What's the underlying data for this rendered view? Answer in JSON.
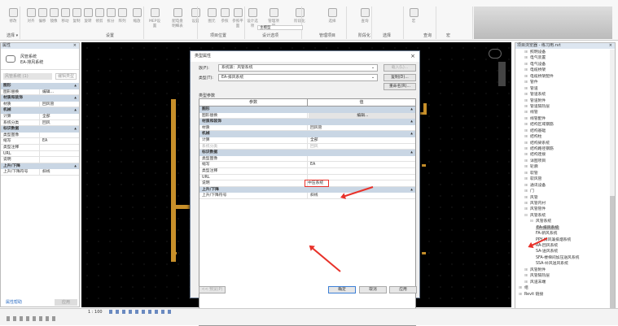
{
  "ribbon": {
    "buttons": [
      "修改",
      "对齐",
      "偏移",
      "镜像",
      "移动",
      "复制",
      "旋转",
      "修剪",
      "拆分",
      "阵列",
      "缩放",
      "MEP设置",
      "配电盘明细表",
      "设置",
      "图元",
      "参照",
      "参照平面",
      "设计选项",
      "管理项目",
      "阶段化",
      "选择",
      "查询",
      "宏"
    ],
    "panels": [
      "选择 ▾",
      "设置",
      "项目位置",
      "设计选项",
      "管理项目",
      "阶段化",
      "选择",
      "查询",
      "宏"
    ],
    "design_option_value": "主模型"
  },
  "properties": {
    "title": "属性",
    "close": "×",
    "type_name": "风管系统",
    "type_sub": "EA-排风系统",
    "selector": "风管系统 (1)",
    "edit_type": "编辑类型",
    "rows": [
      {
        "s": "图形"
      },
      {
        "k": "图形替换",
        "v": "编辑..."
      },
      {
        "s": "材质和装饰"
      },
      {
        "k": "材质",
        "v": "回风管"
      },
      {
        "s": "机械"
      },
      {
        "k": "计算",
        "v": "全部"
      },
      {
        "k": "系统分类",
        "v": "回风"
      },
      {
        "s": "标识数据"
      },
      {
        "k": "类型图像",
        "v": ""
      },
      {
        "k": "缩写",
        "v": "EA"
      },
      {
        "k": "类型注释",
        "v": ""
      },
      {
        "k": "URL",
        "v": ""
      },
      {
        "k": "说明",
        "v": ""
      },
      {
        "s": "上升/下降"
      },
      {
        "k": "上升/下降符号",
        "v": "斜线"
      }
    ],
    "help": "属性帮助",
    "apply": "应用"
  },
  "dialog": {
    "title": "类型属性",
    "close": "×",
    "family_label": "族(F):",
    "family_value": "系统族：风管系统",
    "type_label": "类型(T):",
    "type_value": "EA-排风系统",
    "load": "载入(L)...",
    "duplicate": "复制(D)...",
    "rename": "重命名(R)...",
    "params_label": "类型参数",
    "col_param": "参数",
    "col_value": "值",
    "rows": [
      {
        "s": "图形"
      },
      {
        "k": "图形替换",
        "v": "编辑...",
        "btn": true
      },
      {
        "s": "材质和装饰"
      },
      {
        "k": "材质",
        "v": "回风管"
      },
      {
        "s": "机械"
      },
      {
        "k": "计算",
        "v": "全部"
      },
      {
        "k": "系统分类",
        "v": "回风",
        "grey": true
      },
      {
        "s": "标识数据"
      },
      {
        "k": "类型图像",
        "v": ""
      },
      {
        "k": "缩写",
        "v": "EA"
      },
      {
        "k": "类型注释",
        "v": ""
      },
      {
        "k": "URL",
        "v": ""
      },
      {
        "k": "说明",
        "v": "中压系统",
        "hl": true
      },
      {
        "s": "上升/下降"
      },
      {
        "k": "上升/下降符号",
        "v": "斜线"
      }
    ],
    "preview": "<< 预览(P)",
    "ok": "确定",
    "cancel": "取消",
    "apply": "应用"
  },
  "browser": {
    "title": "项目浏览器 - 练习用.rvt",
    "close": "×",
    "items": [
      {
        "t": "照明设备",
        "l": 1
      },
      {
        "t": "电气装置",
        "l": 1
      },
      {
        "t": "电气设备",
        "l": 1
      },
      {
        "t": "电缆桥架",
        "l": 1
      },
      {
        "t": "电缆桥架配件",
        "l": 1
      },
      {
        "t": "管件",
        "l": 1
      },
      {
        "t": "管道",
        "l": 1
      },
      {
        "t": "管道系统",
        "l": 1
      },
      {
        "t": "管道附件",
        "l": 1
      },
      {
        "t": "管道隔热层",
        "l": 1
      },
      {
        "t": "线管",
        "l": 1
      },
      {
        "t": "线管配件",
        "l": 1
      },
      {
        "t": "结构区域钢筋",
        "l": 1
      },
      {
        "t": "结构基础",
        "l": 1
      },
      {
        "t": "结构柱",
        "l": 1
      },
      {
        "t": "结构梁系统",
        "l": 1
      },
      {
        "t": "结构路径钢筋",
        "l": 1
      },
      {
        "t": "结构连接",
        "l": 1
      },
      {
        "t": "详图项目",
        "l": 1
      },
      {
        "t": "轮廓",
        "l": 1
      },
      {
        "t": "软管",
        "l": 1
      },
      {
        "t": "软风管",
        "l": 1
      },
      {
        "t": "通讯设备",
        "l": 1
      },
      {
        "t": "门",
        "l": 1
      },
      {
        "t": "风管",
        "l": 1
      },
      {
        "t": "风管内衬",
        "l": 1
      },
      {
        "t": "风管管件",
        "l": 1
      },
      {
        "t": "风管系统",
        "l": 1,
        "open": true
      },
      {
        "t": "风管系统",
        "l": 2,
        "open": true
      },
      {
        "t": "EA-排风系统",
        "l": 3,
        "sel": true
      },
      {
        "t": "FA-新风系统",
        "l": 3
      },
      {
        "t": "PPY-排风兼排烟系统",
        "l": 3
      },
      {
        "t": "RA-回风系统",
        "l": 3
      },
      {
        "t": "SA-送风系统",
        "l": 3
      },
      {
        "t": "SFA-楼梯间加压送风系统",
        "l": 3
      },
      {
        "t": "SSA-补风送风系统",
        "l": 3
      },
      {
        "t": "风管附件",
        "l": 1
      },
      {
        "t": "风管隔热层",
        "l": 1
      },
      {
        "t": "风道末端",
        "l": 1
      },
      {
        "t": "组",
        "l": 0
      },
      {
        "t": "Revit 链接",
        "l": 0
      }
    ]
  },
  "status": {
    "scale": "1 : 100"
  },
  "colors": {
    "annotation": "#e8322a",
    "duct": "#c8902a",
    "section": "#c9d6e4"
  }
}
